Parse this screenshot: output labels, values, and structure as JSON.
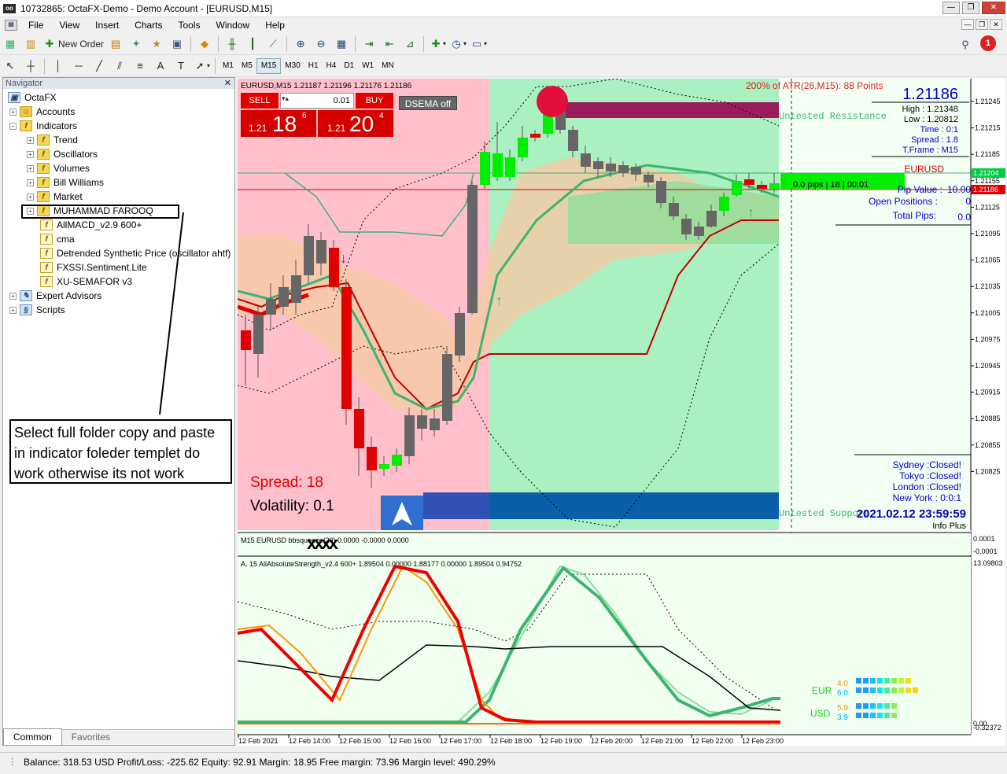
{
  "window": {
    "title": "10732865: OctaFX-Demo - Demo Account - [EURUSD,M15]"
  },
  "menu": [
    "File",
    "View",
    "Insert",
    "Charts",
    "Tools",
    "Window",
    "Help"
  ],
  "toolbar": {
    "new_order": "New Order",
    "timeframes": [
      "M1",
      "M5",
      "M15",
      "M30",
      "H1",
      "H4",
      "D1",
      "W1",
      "MN"
    ],
    "active_tf": "M15",
    "notification_count": "1"
  },
  "navigator": {
    "title": "Navigator",
    "items": [
      {
        "label": "OctaFX"
      },
      {
        "label": "Accounts"
      },
      {
        "label": "Indicators"
      },
      {
        "label": "Trend"
      },
      {
        "label": "Oscillators"
      },
      {
        "label": "Volumes"
      },
      {
        "label": "Bill Williams"
      },
      {
        "label": "Market"
      },
      {
        "label": "MUHAMMAD FAROOQ"
      },
      {
        "label": "AllMACD_v2.9 600+"
      },
      {
        "label": "cma"
      },
      {
        "label": "Detrended Synthetic Price (oscillator ahtf)"
      },
      {
        "label": "FXSSI.Sentiment.Lite"
      },
      {
        "label": "XU-SEMAFOR v3"
      },
      {
        "label": "Expert Advisors"
      },
      {
        "label": "Scripts"
      }
    ],
    "tabs": [
      "Common",
      "Favorites"
    ]
  },
  "annotation": {
    "line1": "Select  full folder copy and paste",
    "line2": "in indicator  foleder templet do",
    "line3": "work otherwise its not work"
  },
  "chart": {
    "header": "EURUSD,M15  1.21187 1.21196 1.21176 1.21186",
    "sell_label": "SELL",
    "buy_label": "BUY",
    "lot": "0.01",
    "sell_price_small": "1.21",
    "sell_price_big": "18",
    "sell_price_sup": "6",
    "buy_price_small": "1.21",
    "buy_price_big": "20",
    "buy_price_sup": "4",
    "dsema": "DSEMA off",
    "atr": "200% of ATR(26,M15): 88  Points",
    "price_big": "1.21186",
    "high": "High : 1.21348",
    "low": "Low : 1.20812",
    "time": "Time :       0:1",
    "spread": "Spread :       1.8",
    "tframe": "T.Frame :    M15",
    "symbol": "EURUSD",
    "pips": "0.0 pips | 18 | 00:01",
    "pip_value_label": "Pip Value :",
    "pip_value": "10.00",
    "open_pos_label": "Open Positions :",
    "open_pos": "0",
    "total_pips_label": "Total Pips:",
    "total_pips": "0.0",
    "untested_res": "Untested Resistance",
    "untested_sup": "Untested Support",
    "spread_big": "Spread: 18",
    "volatility": "Volatility: 0.1",
    "sessions": [
      "Sydney :Closed!",
      "Tokyo :Closed!",
      "London :Closed!",
      "New York :   0:0:1"
    ],
    "datetime": "2021.02.12 23:59:59",
    "info_plus": "Info Plus",
    "price_axis": [
      "1.21245",
      "1.21215",
      "1.21185",
      "1.21155",
      "1.21125",
      "1.21095",
      "1.21065",
      "1.21035",
      "1.21005",
      "1.20975",
      "1.20945",
      "1.20915",
      "1.20885",
      "1.20855",
      "1.20825"
    ],
    "price_tags": {
      "green": "1.21204",
      "red": "1.21186"
    },
    "sub1": {
      "label": "M15 EURUSD bbsqueeze(20)  0.0000 -0.0000 0.0000",
      "axis_top": "0.0001",
      "axis_bot": "-0.0001"
    },
    "sub2": {
      "label": "A. 15 AllAbsoluteStrength_v2.4 600+ 1.89504 0.00000 1.88177 0.00000 1.89504 0.94752",
      "axis_top": "13.09803",
      "axis_bot": "0.00",
      "axis_bot2": "-0.32372",
      "eur_label": "EUR",
      "eur_a": "4.0",
      "eur_b": "6.0",
      "usd_label": "USD",
      "usd_a": "5.9",
      "usd_b": "3.9"
    },
    "time_axis": [
      "12 Feb 2021",
      "12 Feb 14:00",
      "12 Feb 15:00",
      "12 Feb 16:00",
      "12 Feb 17:00",
      "12 Feb 18:00",
      "12 Feb 19:00",
      "12 Feb 20:00",
      "12 Feb 21:00",
      "12 Feb 22:00",
      "12 Feb 23:00"
    ]
  },
  "status": {
    "text": "Balance: 318.53 USD  Profit/Loss: -225.62  Equity: 92.91  Margin: 18.95  Free margin: 73.96  Margin level: 490.29%"
  },
  "colors": {
    "bull": "#00ee00",
    "bear": "#ff0000",
    "neutral_candle": "#666666",
    "bg_green": "#aaf0c0",
    "bg_red": "#ffc0cc",
    "eur_line": "#ff9900",
    "usd_line": "#3cb371"
  }
}
